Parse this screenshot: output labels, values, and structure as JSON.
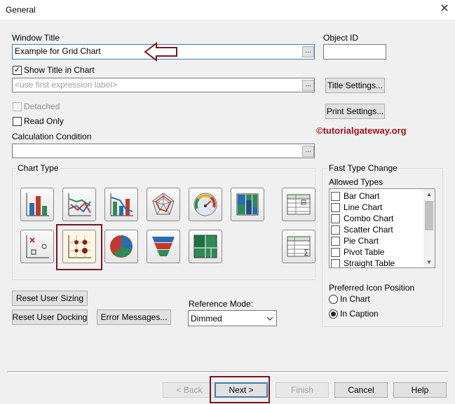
{
  "window": {
    "title": "General",
    "close_icon": "✕"
  },
  "window_title": {
    "label": "Window Title",
    "value": "Example for Grid Chart"
  },
  "object_id": {
    "label": "Object ID",
    "value": ""
  },
  "show_title": {
    "label": "Show Title in Chart",
    "checked": true
  },
  "title_expression": {
    "placeholder": "<use first expression label>"
  },
  "title_settings_button": "Title Settings...",
  "print_settings_button": "Print Settings...",
  "detached": {
    "label": "Detached",
    "checked": false,
    "disabled": true
  },
  "read_only": {
    "label": "Read Only",
    "checked": false
  },
  "calculation_condition": {
    "label": "Calculation Condition",
    "value": ""
  },
  "browse_button": "...",
  "watermark": "©tutorialgateway.org",
  "chart_type": {
    "label": "Chart Type",
    "icons": [
      "bar-chart-icon",
      "line-chart-icon",
      "combo-chart-icon",
      "radar-chart-icon",
      "gauge-chart-icon",
      "mekko-chart-icon",
      "pivot-table-icon",
      "scatter-chart-icon",
      "grid-chart-icon",
      "pie-chart-icon",
      "funnel-chart-icon",
      "block-chart-icon",
      "straight-table-icon"
    ],
    "selected": "grid-chart-icon"
  },
  "fast_type_change": {
    "label": "Fast Type Change",
    "allowed_label": "Allowed Types",
    "items": [
      "Bar Chart",
      "Line Chart",
      "Combo Chart",
      "Scatter Chart",
      "Pie Chart",
      "Pivot Table",
      "Straight Table"
    ]
  },
  "preferred_icon_position": {
    "label": "Preferred Icon Position",
    "options": [
      "In Chart",
      "In Caption"
    ],
    "selected": "In Caption"
  },
  "reset_user_sizing": "Reset User Sizing",
  "reset_user_docking": "Reset User Docking",
  "error_messages": "Error Messages...",
  "reference_mode": {
    "label": "Reference Mode:",
    "value": "Dimmed"
  },
  "footer": {
    "back": "< Back",
    "next": "Next >",
    "finish": "Finish",
    "cancel": "Cancel",
    "help": "Help"
  },
  "colors": {
    "annotation_red": "#7b1420",
    "watermark_red": "#a0141e",
    "focus_blue": "#3c7fb1"
  }
}
